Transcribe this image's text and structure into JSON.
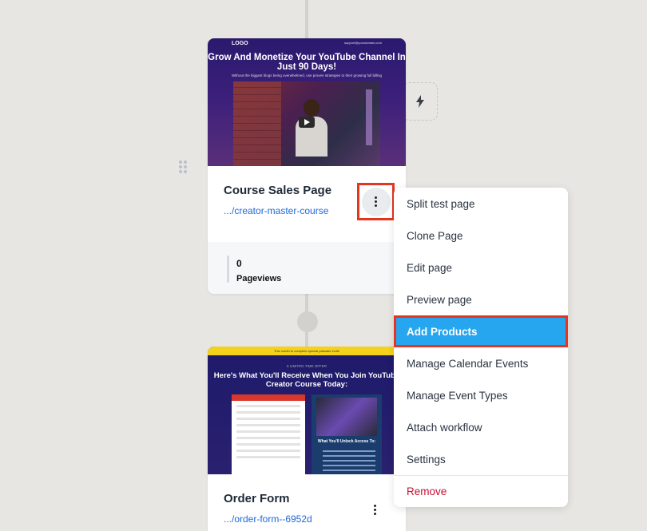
{
  "page1": {
    "thumbnail": {
      "logo": "LOGO",
      "email": "support@yourdomain.com",
      "headline": "Grow And Monetize Your YouTube Channel In Just 90 Days!",
      "subheadline": "Without the biggest blogs being overwhelmed, use proven strategies to their growing full billing"
    },
    "title": "Course Sales Page",
    "link": ".../creator-master-course",
    "stats": {
      "value": "0",
      "label": "Pageviews"
    }
  },
  "page2": {
    "thumbnail": {
      "banner": "This month to complete special pabsaler invite",
      "kicker": "5 LIMITED TIME OFFER",
      "headline": "Here's What You'll Receive When You Join YouTube Creator Course Today:",
      "promo_caption": "What You'll Unlock Access To:"
    },
    "title": "Order Form",
    "link": ".../order-form--6952d"
  },
  "menu": {
    "items": [
      {
        "label": "Split test page"
      },
      {
        "label": "Clone Page"
      },
      {
        "label": "Edit page"
      },
      {
        "label": "Preview page"
      },
      {
        "label": "Add Products",
        "active": true
      },
      {
        "label": "Manage Calendar Events"
      },
      {
        "label": "Manage Event Types"
      },
      {
        "label": "Attach workflow"
      },
      {
        "label": "Settings"
      },
      {
        "label": "Remove",
        "danger": true
      }
    ]
  },
  "icons": {
    "action": "lightning-icon",
    "drag": "drag-handle-icon",
    "more": "kebab-menu-icon"
  },
  "colors": {
    "highlight_border": "#e53521",
    "active_item": "#25a6ee",
    "link": "#1d68d8",
    "danger": "#c8102e"
  }
}
